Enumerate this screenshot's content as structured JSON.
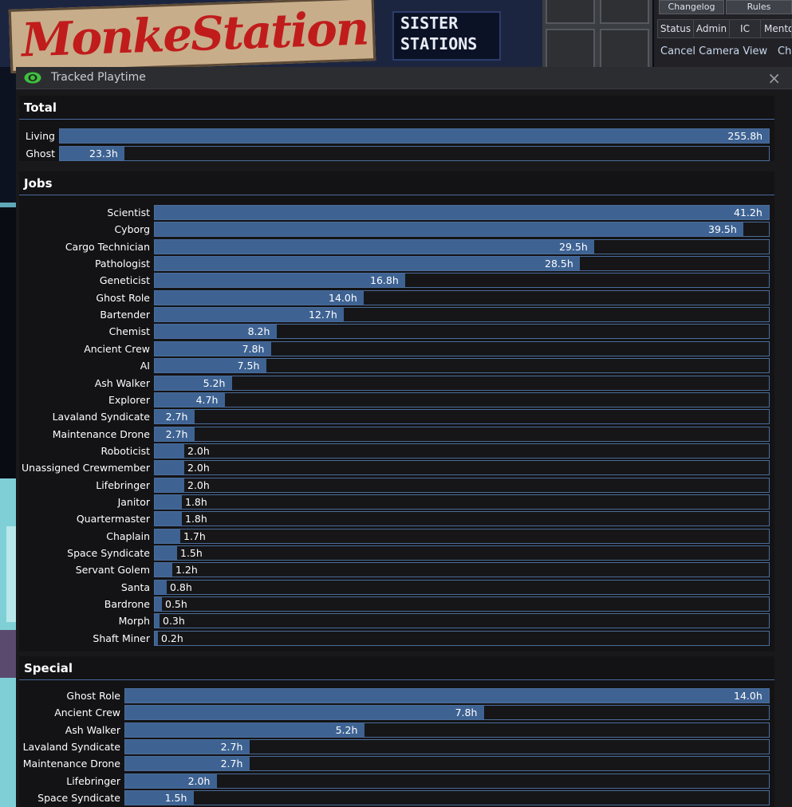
{
  "background": {
    "logo_text": "MonkeStation",
    "sister_line1": "SISTER",
    "sister_line2": "STATIONS"
  },
  "sidepanel": {
    "changelog": "Changelog",
    "rules": "Rules",
    "tabs": [
      "Status",
      "Admin",
      "IC",
      "Mentor"
    ],
    "cancel_camera": "Cancel Camera View",
    "extra": "Cha"
  },
  "window": {
    "title": "Tracked Playtime",
    "close": "×"
  },
  "sections": {
    "total": {
      "title": "Total",
      "max": 255.8,
      "rows": [
        {
          "label": "Living",
          "value": 255.8,
          "text": "255.8h"
        },
        {
          "label": "Ghost",
          "value": 23.3,
          "text": "23.3h"
        }
      ]
    },
    "jobs": {
      "title": "Jobs",
      "max": 41.2,
      "rows": [
        {
          "label": "Scientist",
          "value": 41.2,
          "text": "41.2h"
        },
        {
          "label": "Cyborg",
          "value": 39.5,
          "text": "39.5h"
        },
        {
          "label": "Cargo Technician",
          "value": 29.5,
          "text": "29.5h"
        },
        {
          "label": "Pathologist",
          "value": 28.5,
          "text": "28.5h"
        },
        {
          "label": "Geneticist",
          "value": 16.8,
          "text": "16.8h"
        },
        {
          "label": "Ghost Role",
          "value": 14.0,
          "text": "14.0h"
        },
        {
          "label": "Bartender",
          "value": 12.7,
          "text": "12.7h"
        },
        {
          "label": "Chemist",
          "value": 8.2,
          "text": "8.2h"
        },
        {
          "label": "Ancient Crew",
          "value": 7.8,
          "text": "7.8h"
        },
        {
          "label": "AI",
          "value": 7.5,
          "text": "7.5h"
        },
        {
          "label": "Ash Walker",
          "value": 5.2,
          "text": "5.2h"
        },
        {
          "label": "Explorer",
          "value": 4.7,
          "text": "4.7h"
        },
        {
          "label": "Lavaland Syndicate",
          "value": 2.7,
          "text": "2.7h"
        },
        {
          "label": "Maintenance Drone",
          "value": 2.7,
          "text": "2.7h"
        },
        {
          "label": "Roboticist",
          "value": 2.0,
          "text": "2.0h"
        },
        {
          "label": "Unassigned Crewmember",
          "value": 2.0,
          "text": "2.0h"
        },
        {
          "label": "Lifebringer",
          "value": 2.0,
          "text": "2.0h"
        },
        {
          "label": "Janitor",
          "value": 1.8,
          "text": "1.8h"
        },
        {
          "label": "Quartermaster",
          "value": 1.8,
          "text": "1.8h"
        },
        {
          "label": "Chaplain",
          "value": 1.7,
          "text": "1.7h"
        },
        {
          "label": "Space Syndicate",
          "value": 1.5,
          "text": "1.5h"
        },
        {
          "label": "Servant Golem",
          "value": 1.2,
          "text": "1.2h"
        },
        {
          "label": "Santa",
          "value": 0.8,
          "text": "0.8h"
        },
        {
          "label": "Bardrone",
          "value": 0.5,
          "text": "0.5h"
        },
        {
          "label": "Morph",
          "value": 0.3,
          "text": "0.3h"
        },
        {
          "label": "Shaft Miner",
          "value": 0.2,
          "text": "0.2h"
        }
      ]
    },
    "special": {
      "title": "Special",
      "max": 14.0,
      "rows": [
        {
          "label": "Ghost Role",
          "value": 14.0,
          "text": "14.0h"
        },
        {
          "label": "Ancient Crew",
          "value": 7.8,
          "text": "7.8h"
        },
        {
          "label": "Ash Walker",
          "value": 5.2,
          "text": "5.2h"
        },
        {
          "label": "Lavaland Syndicate",
          "value": 2.7,
          "text": "2.7h"
        },
        {
          "label": "Maintenance Drone",
          "value": 2.7,
          "text": "2.7h"
        },
        {
          "label": "Lifebringer",
          "value": 2.0,
          "text": "2.0h"
        },
        {
          "label": "Space Syndicate",
          "value": 1.5,
          "text": "1.5h"
        }
      ]
    }
  },
  "colors": {
    "bar_fill": "#3e6393",
    "bar_border": "#4b6c9a",
    "section_bg": "#131315",
    "window_bg": "#222327"
  }
}
